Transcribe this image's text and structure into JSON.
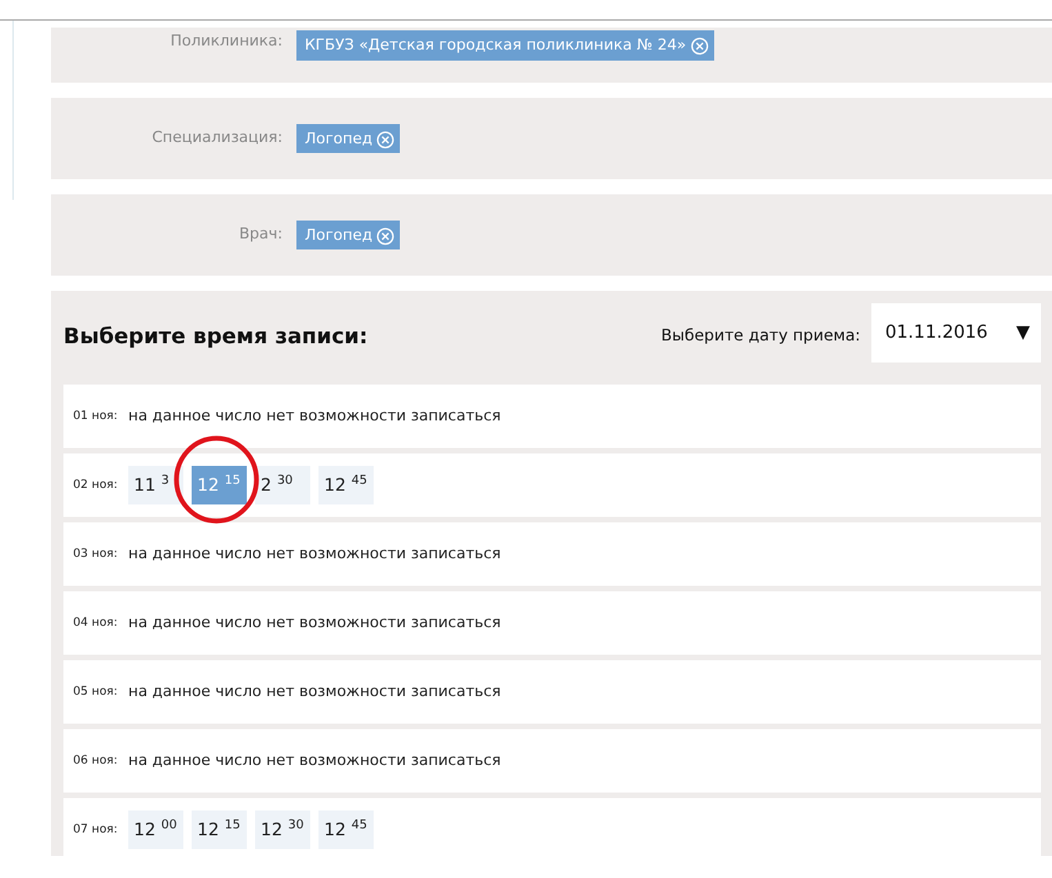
{
  "filters": [
    {
      "label": "Поликлиника:",
      "value": "КГБУЗ «Детская городская поликлиника № 24»"
    },
    {
      "label": "Специализация:",
      "value": "Логопед"
    },
    {
      "label": "Врач:",
      "value": "Логопед"
    }
  ],
  "schedule": {
    "title": "Выберите время записи:",
    "date_label": "Выберите дату приема:",
    "date_value": "01.11.2016",
    "date_caret": "▼",
    "days": [
      {
        "date": "01 ноя:",
        "kind": "message",
        "message": "на данное число нет возможности записаться"
      },
      {
        "date": "02 ноя:",
        "kind": "slots",
        "slots": [
          {
            "time": "11 $^{3}$",
            "selected": false
          },
          {
            "time": "12 $^{15}$",
            "selected": true
          },
          {
            "time": "2 $^{30}$",
            "selected": false
          },
          {
            "time": "12 $^{45}$",
            "selected": false
          }
        ]
      },
      {
        "date": "03 ноя:",
        "kind": "message",
        "message": "на данное число нет возможности записаться"
      },
      {
        "date": "04 ноя:",
        "kind": "message",
        "message": "на данное число нет возможности записаться"
      },
      {
        "date": "05 ноя:",
        "kind": "message",
        "message": "на данное число нет возможности записаться"
      },
      {
        "date": "06 ноя:",
        "kind": "message",
        "message": "на данное число нет возможности записаться"
      },
      {
        "date": "07 ноя:",
        "kind": "slots",
        "slots": [
          {
            "time": "12 $^{00}$",
            "selected": false
          },
          {
            "time": "12 $^{15}$",
            "selected": false
          },
          {
            "time": "12 $^{30}$",
            "selected": false
          },
          {
            "time": "12 $^{45}$",
            "selected": false
          }
        ]
      }
    ]
  }
}
